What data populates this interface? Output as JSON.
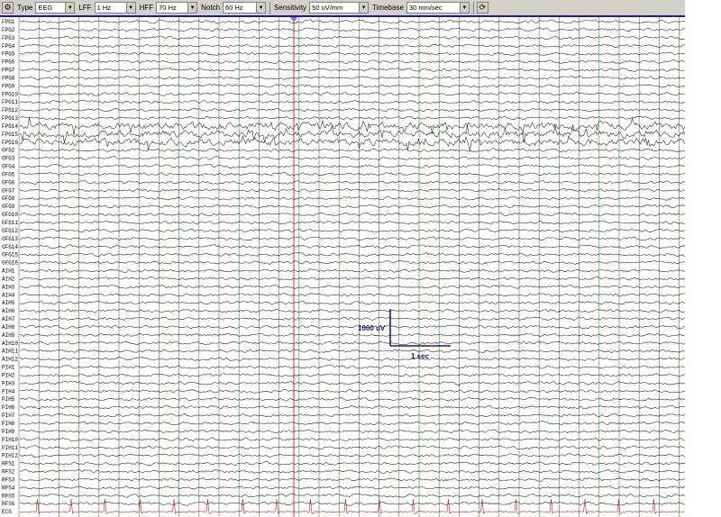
{
  "toolbar": {
    "type_label": "Type",
    "type_value": "EEG",
    "lff_label": "LFF",
    "lff_value": "1 Hz",
    "hff_label": "HFF",
    "hff_value": "70 Hz",
    "notch_label": "Notch",
    "notch_value": "60 Hz",
    "sensitivity_label": "Sensitivity",
    "sensitivity_value": "50 uV/mm",
    "timebase_label": "Timebase",
    "timebase_value": "30 mm/sec",
    "icons": [
      "settings-icon",
      "refresh-icon"
    ]
  },
  "channels": [
    "FPG1",
    "FPG2",
    "FPG3",
    "FPG4",
    "FPG5",
    "FPG6",
    "FPG7",
    "FPG8",
    "FPG9",
    "FPG10",
    "FPG11",
    "FPG12",
    "FPG13",
    "FPG14",
    "FPG15",
    "FPG16",
    "OFG2",
    "OFG3",
    "OFG4",
    "OFG5",
    "OFG6",
    "OFG7",
    "OFG8",
    "OFG9",
    "OFG10",
    "OFG11",
    "OFG12",
    "OFG13",
    "OFG14",
    "OFG15",
    "OFG16",
    "AIH1",
    "AIH2",
    "AIH3",
    "AIH4",
    "AIH5",
    "AIH6",
    "AIH7",
    "AIH8",
    "AIH9",
    "AIH10",
    "AIH11",
    "AIH12",
    "PIH1",
    "PIH2",
    "PIH3",
    "PIH4",
    "PIH5",
    "PIH6",
    "PIH7",
    "PIH8",
    "PIH9",
    "PIH10",
    "PIH11",
    "PIH12",
    "RFS1",
    "RFS2",
    "RFS3",
    "RFS4",
    "RFS5",
    "RFS6",
    "ECG"
  ],
  "calibration": {
    "amplitude_label": "1000 uV",
    "time_label": "1 sec"
  },
  "colors": {
    "grid": "#2e8b2e",
    "trace": "#1c1c1c",
    "ecg": "#cc0000",
    "marker": "#cc0000",
    "calibration": "#1a1a8a"
  }
}
